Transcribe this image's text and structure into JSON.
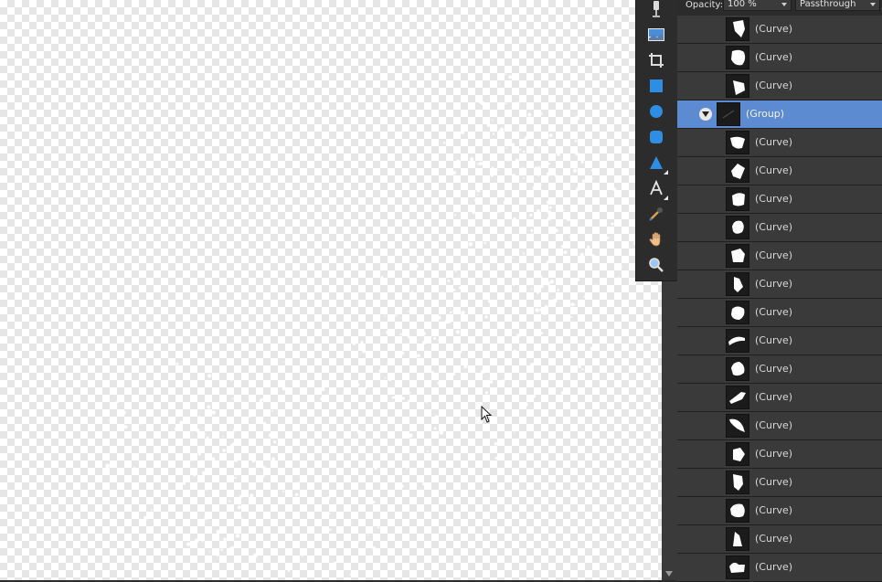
{
  "panel": {
    "opacity_label": "Opacity:",
    "opacity_value": "100 %",
    "blend_mode": "Passthrough"
  },
  "tools": [
    {
      "name": "pointer-tool-icon"
    },
    {
      "name": "place-image-tool-icon"
    },
    {
      "name": "crop-tool-icon"
    },
    {
      "name": "rectangle-tool-icon"
    },
    {
      "name": "ellipse-tool-icon"
    },
    {
      "name": "rounded-rectangle-tool-icon"
    },
    {
      "name": "triangle-tool-icon"
    },
    {
      "name": "text-tool-icon"
    },
    {
      "name": "color-picker-tool-icon"
    },
    {
      "name": "hand-tool-icon"
    },
    {
      "name": "zoom-tool-icon"
    }
  ],
  "layers": [
    {
      "name": "(Curve)",
      "shape": 0
    },
    {
      "name": "(Curve)",
      "shape": 1
    },
    {
      "name": "(Curve)",
      "shape": 2
    },
    {
      "name": "(Group)",
      "group": true,
      "selected": true
    },
    {
      "name": "(Curve)",
      "shape": 3
    },
    {
      "name": "(Curve)",
      "shape": 4
    },
    {
      "name": "(Curve)",
      "shape": 5
    },
    {
      "name": "(Curve)",
      "shape": 6
    },
    {
      "name": "(Curve)",
      "shape": 7
    },
    {
      "name": "(Curve)",
      "shape": 8
    },
    {
      "name": "(Curve)",
      "shape": 9
    },
    {
      "name": "(Curve)",
      "shape": 10
    },
    {
      "name": "(Curve)",
      "shape": 11
    },
    {
      "name": "(Curve)",
      "shape": 12
    },
    {
      "name": "(Curve)",
      "shape": 13
    },
    {
      "name": "(Curve)",
      "shape": 14
    },
    {
      "name": "(Curve)",
      "shape": 15
    },
    {
      "name": "(Curve)",
      "shape": 16
    },
    {
      "name": "(Curve)",
      "shape": 17
    },
    {
      "name": "(Curve)",
      "shape": 18
    }
  ]
}
